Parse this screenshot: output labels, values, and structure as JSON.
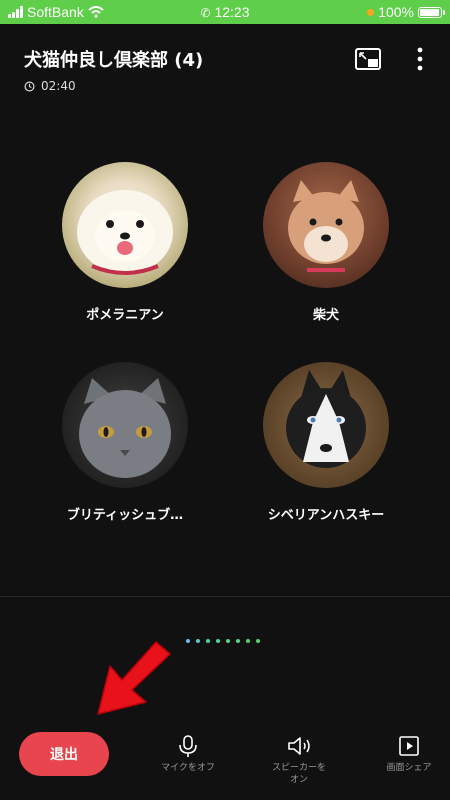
{
  "status_bar": {
    "carrier": "SoftBank",
    "time": "12:23",
    "battery": "100%",
    "battery_level": 1.0
  },
  "header": {
    "title": "犬猫仲良し倶楽部 (4)",
    "elapsed": "02:40",
    "icons": [
      "clock-icon",
      "pip-icon",
      "more-vertical-icon"
    ]
  },
  "participants": [
    {
      "name": "ポメラニアン",
      "avatar": "pomeranian"
    },
    {
      "name": "柴犬",
      "avatar": "shiba"
    },
    {
      "name": "ブリティッシュブ…",
      "avatar": "british-shorthair"
    },
    {
      "name": "シベリアンハスキー",
      "avatar": "husky"
    }
  ],
  "pager": {
    "dot_colors": [
      "#6fb8f0",
      "#58c7c4",
      "#4fd1a0",
      "#4fd1a0",
      "#52d48a",
      "#52d48a",
      "#5ad070",
      "#5ad070"
    ]
  },
  "controls": {
    "leave": "退出",
    "mic": "マイクをオフ",
    "speaker_line1": "スピーカーを",
    "speaker_line2": "オン",
    "screen_share": "画面シェア"
  },
  "colors": {
    "background": "#111111",
    "status_bar": "#5fce4a",
    "leave_button": "#e8454e",
    "arrow": "#e8121a"
  }
}
